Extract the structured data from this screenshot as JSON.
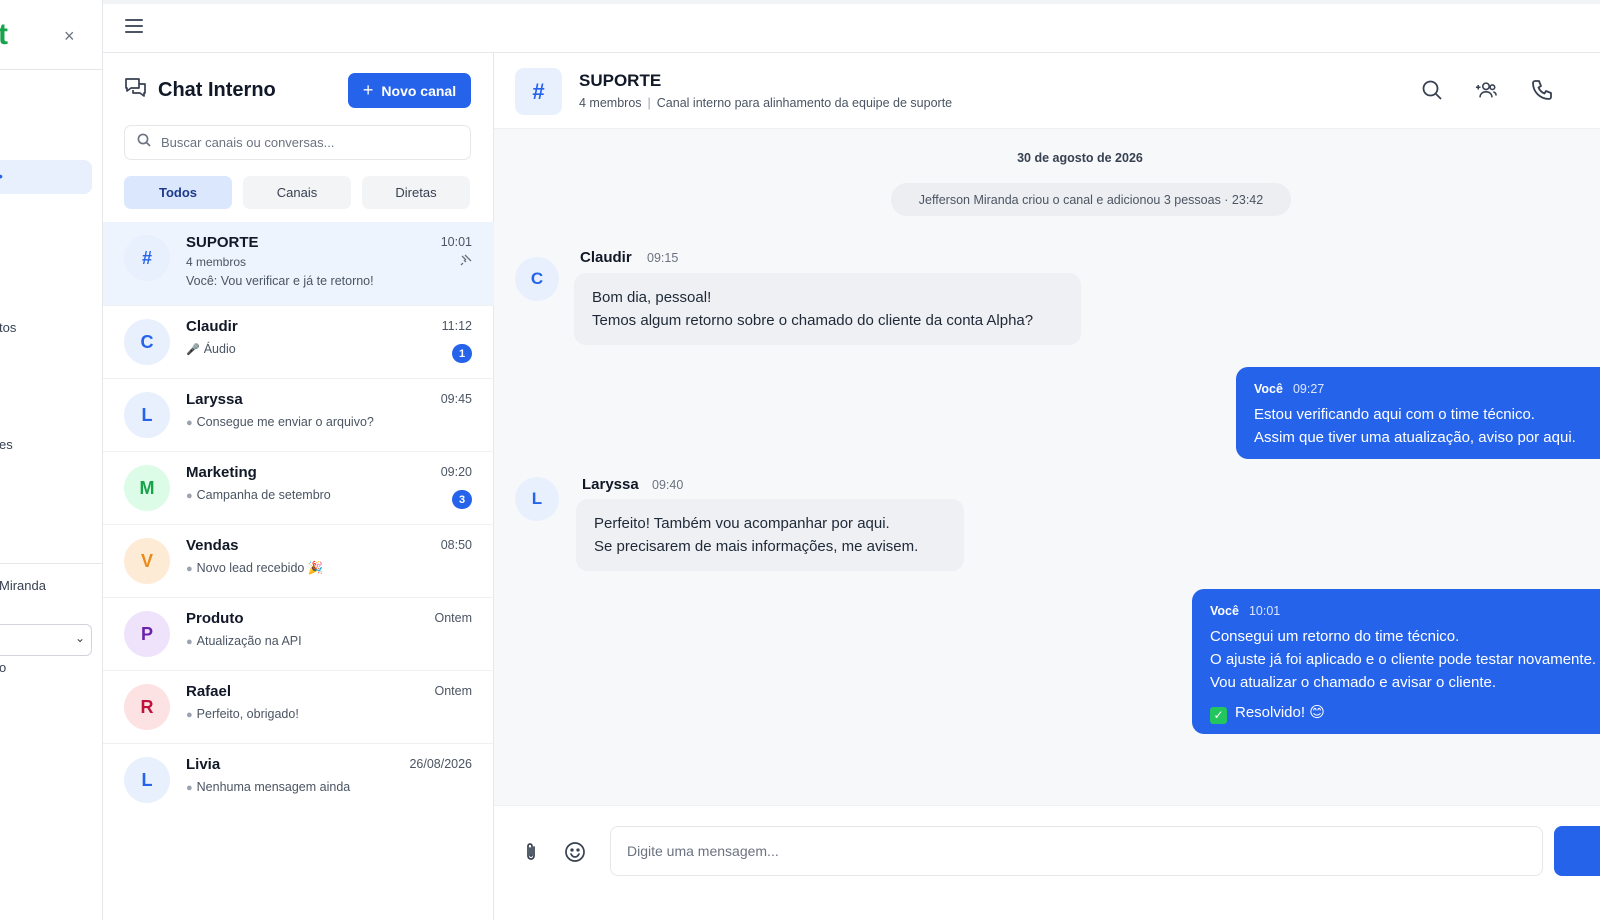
{
  "sidebar": {
    "brand_fragment": "t",
    "close_label": "×",
    "items": [
      "tos",
      "es"
    ],
    "user_fragment": "Miranda",
    "select_fragment": "",
    "bottom_fragment": "o"
  },
  "list": {
    "title": "Chat Interno",
    "new_channel_label": "Novo canal",
    "search_placeholder": "Buscar canais ou conversas...",
    "tabs": [
      "Todos",
      "Canais",
      "Diretas"
    ],
    "active_tab": "Todos",
    "conversations": [
      {
        "initial": "#",
        "name": "SUPORTE",
        "sub": "4 membros",
        "preview": "Você: Vou verificar e já te retorno!",
        "time": "10:01",
        "badge": "",
        "avatar_bg": "#e8f0fe",
        "avatar_fg": "#2563eb"
      },
      {
        "initial": "C",
        "name": "Claudir",
        "preview": "Áudio",
        "time": "11:12",
        "badge": "1",
        "avatar_bg": "#e8f0fe",
        "avatar_fg": "#2563eb"
      },
      {
        "initial": "L",
        "name": "Laryssa",
        "preview": "Consegue me enviar o arquivo?",
        "time": "09:45",
        "badge": "",
        "avatar_bg": "#e8f0fe",
        "avatar_fg": "#2563eb"
      },
      {
        "initial": "M",
        "name": "Marketing",
        "preview": "Campanha de setembro",
        "time": "09:20",
        "badge": "3",
        "avatar_bg": "#dcfce7",
        "avatar_fg": "#16a34a"
      },
      {
        "initial": "V",
        "name": "Vendas",
        "preview": "Novo lead recebido 🎉",
        "time": "08:50",
        "badge": "",
        "avatar_bg": "#fdebd5",
        "avatar_fg": "#ea8a1a"
      },
      {
        "initial": "P",
        "name": "Produto",
        "preview": "Atualização na API",
        "time": "Ontem",
        "badge": "",
        "avatar_bg": "#efe3fb",
        "avatar_fg": "#6b21a8"
      },
      {
        "initial": "R",
        "name": "Rafael",
        "preview": "Perfeito, obrigado!",
        "time": "Ontem",
        "badge": "",
        "avatar_bg": "#fde2e4",
        "avatar_fg": "#be123c"
      },
      {
        "initial": "L",
        "name": "Livia",
        "preview": "Nenhuma mensagem ainda",
        "time": "26/08/2026",
        "badge": "",
        "avatar_bg": "#e8f0fe",
        "avatar_fg": "#2563eb"
      }
    ]
  },
  "chat": {
    "channel_icon": "#",
    "title": "SUPORTE",
    "members": "4 membros",
    "separator": "|",
    "description": "Canal interno para alinhamento da equipe de suporte",
    "date": "30 de agosto de 2026",
    "system_message": "Jefferson Miranda criou o canal e adicionou 3 pessoas · 23:42",
    "messages": [
      {
        "author": "Claudir",
        "initial": "C",
        "time": "09:15",
        "lines": [
          "Bom dia, pessoal!",
          "Temos algum retorno sobre o chamado do cliente da conta Alpha?"
        ]
      },
      {
        "author": "Você",
        "time": "09:27",
        "lines": [
          "Estou verificando aqui com o time técnico.",
          "Assim que tiver uma atualização, aviso por aqui."
        ]
      },
      {
        "author": "Laryssa",
        "initial": "L",
        "time": "09:40",
        "lines": [
          "Perfeito! Também vou acompanhar por aqui.",
          "Se precisarem de mais informações, me avisem."
        ]
      },
      {
        "author": "Você",
        "time": "10:01",
        "lines": [
          "Consegui um retorno do time técnico.",
          "O ajuste já foi aplicado e o cliente pode testar novamente.",
          "Vou atualizar o chamado e avisar o cliente."
        ],
        "status_text": "Resolvido! 😊"
      }
    ],
    "composer_placeholder": "Digite uma mensagem..."
  },
  "colors": {
    "accent": "#2563eb",
    "brand": "#16a34a"
  }
}
